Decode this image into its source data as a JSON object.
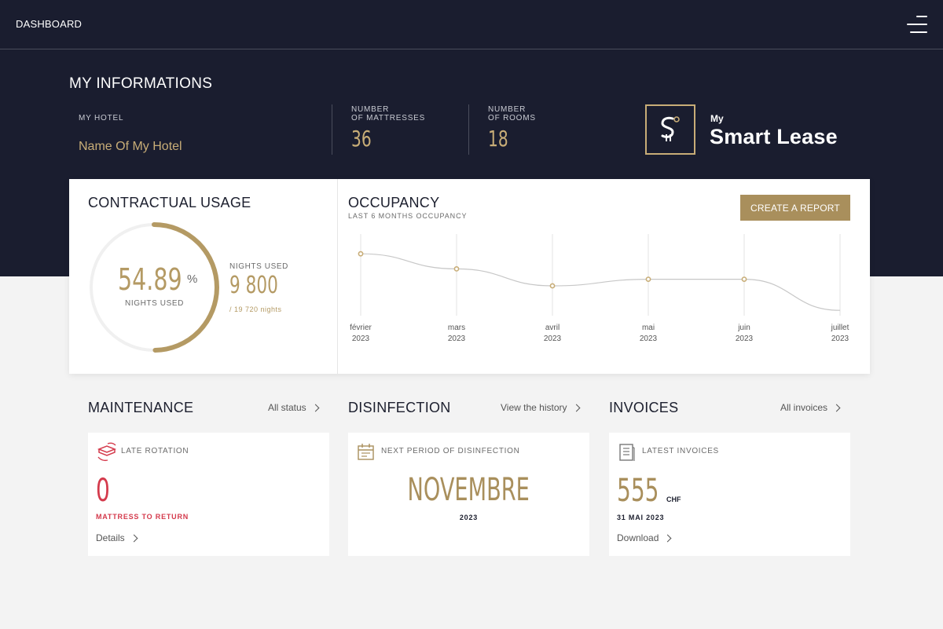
{
  "topbar": {
    "title": "DASHBOARD",
    "menu_icon": "hamburger-menu-icon"
  },
  "info": {
    "title": "MY INFORMATIONS",
    "hotel_label": "MY HOTEL",
    "hotel_name": "Name Of My Hotel",
    "mattresses_label_1": "NUMBER",
    "mattresses_label_2": "OF MATTRESSES",
    "mattresses_value": "36",
    "rooms_label_1": "NUMBER",
    "rooms_label_2": "OF ROOMS",
    "rooms_value": "18"
  },
  "logo": {
    "my": "My",
    "name": "Smart Lease",
    "icon": "smart-lease-logo-icon"
  },
  "usage": {
    "title": "CONTRACTUAL USAGE",
    "percent": "54.89",
    "percent_sign": "%",
    "percent_label": "NIGHTS USED",
    "percent_fraction": 0.4969,
    "nights_label": "NIGHTS USED",
    "nights_value": "9 800",
    "nights_total": "/ 19 720 nights"
  },
  "occupancy": {
    "title": "OCCUPANCY",
    "subtitle": "LAST 6 MONTHS OCCUPANCY",
    "report_button": "CREATE A REPORT"
  },
  "chart_data": {
    "type": "line",
    "categories": [
      [
        "février",
        "2023"
      ],
      [
        "mars",
        "2023"
      ],
      [
        "avril",
        "2023"
      ],
      [
        "mai",
        "2023"
      ],
      [
        "juin",
        "2023"
      ],
      [
        "juillet",
        "2023"
      ]
    ],
    "series": [
      {
        "values": [
          0.79,
          0.63,
          0.45,
          0.52,
          0.52,
          0.19
        ],
        "markers": [
          true,
          true,
          true,
          true,
          true,
          false
        ]
      }
    ],
    "ylim": [
      0,
      1
    ],
    "grid": "vertical",
    "line_color": "#c7c7c7",
    "marker_color": "#c8ad77"
  },
  "maintenance": {
    "title": "MAINTENANCE",
    "link": "All status",
    "card_icon": "mattress-rotation-icon",
    "card_head": "LATE ROTATION",
    "value": "0",
    "value_label": "MATTRESS TO RETURN",
    "card_link": "Details"
  },
  "disinfection": {
    "title": "DISINFECTION",
    "link": "View the history",
    "card_icon": "calendar-icon",
    "card_head": "NEXT PERIOD OF DISINFECTION",
    "month": "NOVEMBRE",
    "year": "2023"
  },
  "invoices": {
    "title": "INVOICES",
    "link": "All invoices",
    "card_icon": "invoice-icon",
    "card_head": "LATEST INVOICES",
    "amount": "555",
    "currency": "CHF",
    "date": "31 MAI 2023",
    "card_link": "Download"
  },
  "colors": {
    "navy": "#1a1d2f",
    "gold": "#c8ad77",
    "gold_dark": "#a98f5c",
    "red": "#d43a4c"
  }
}
